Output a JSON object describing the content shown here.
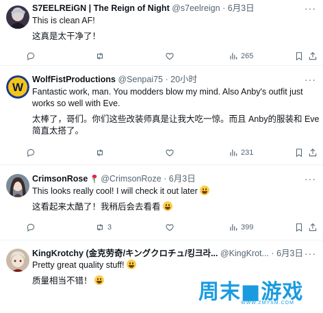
{
  "posts": [
    {
      "display_name": "S7EELREiGN | The Reign of Night",
      "handle": "@s7eelreign",
      "time": "6月3日",
      "lines": [
        "This is clean AF!",
        "",
        "这真是太干净了！"
      ],
      "replies": "",
      "reposts": "",
      "views": "265"
    },
    {
      "display_name": "WolfFistProductions",
      "handle": "@Senpai75",
      "time": "20小时",
      "lines": [
        "Fantastic work, man. You modders blow my mind. Also Anby's outfit just",
        "works so well with Eve.",
        "",
        "太棒了，哥们。你们这些改装师真是让我大吃一惊。而且 Anby的服装和 Eve",
        "简直太搭了。"
      ],
      "replies": "",
      "reposts": "",
      "views": "231"
    },
    {
      "display_name": "CrimsonRose",
      "handle": "@CrimsonRoze",
      "time": "6月3日",
      "lines": [
        "This looks really cool! I will check it out later",
        "",
        "这看起来太酷了！我稍后会去看看"
      ],
      "replies": "",
      "reposts": "3",
      "views": "399"
    },
    {
      "display_name": "KingKrotchy (金克劳奇/キングクロチュ/킹크라...",
      "handle": "@KingKrot...",
      "time": "6月3日",
      "lines": [
        "Pretty great quality stuff!",
        "",
        "质量相当不错！"
      ]
    }
  ],
  "separator": "·",
  "watermark": {
    "text": "周末■游戏",
    "url": "WWW.ZMYSM.COM"
  },
  "icons": [
    "more-icon",
    "reply-icon",
    "repost-icon",
    "like-icon",
    "views-icon",
    "bookmark-icon",
    "share-icon",
    "flower-icon",
    "grin-emoji-icon"
  ]
}
